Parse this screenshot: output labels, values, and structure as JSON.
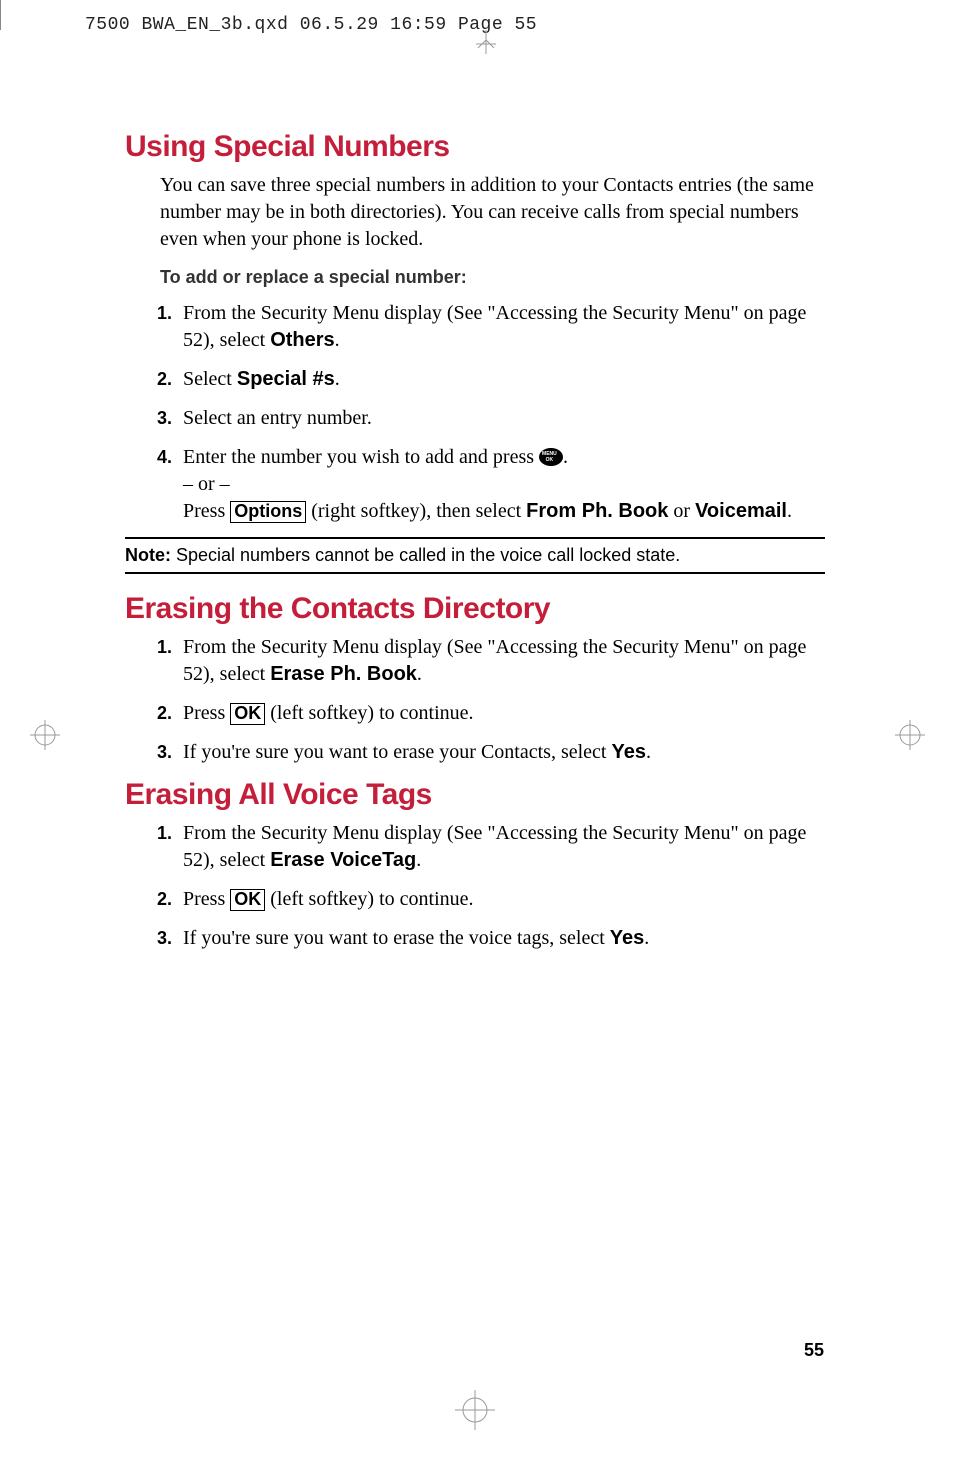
{
  "header_line": "7500 BWA_EN_3b.qxd  06.5.29  16:59  Page 55",
  "section1": {
    "heading": "Using Special Numbers",
    "intro": "You can save three special numbers in addition to your Contacts entries (the same number may be in both directories). You can receive calls from special numbers even when your phone is locked.",
    "subhead": "To add or replace a special number:",
    "step1_a": "From the Security Menu display (See \"Accessing the Security Menu\" on page 52), select ",
    "step1_b": "Others",
    "step2_a": "Select ",
    "step2_b": "Special #s",
    "step3": "Select an entry number.",
    "step4_a": "Enter the number you wish to add and press ",
    "step4_b": ".",
    "step4_or": "– or –",
    "step4_c": "Press ",
    "step4_options": "Options",
    "step4_d": " (right softkey), then select ",
    "step4_e": "From Ph. Book",
    "step4_f": " or ",
    "step4_g": "Voicemail",
    "note_label": "Note:",
    "note_text": " Special numbers cannot be called in the voice call locked state."
  },
  "section2": {
    "heading": "Erasing the Contacts Directory",
    "step1_a": "From the Security Menu display (See \"Accessing the Security Menu\" on page 52), select ",
    "step1_b": "Erase Ph. Book",
    "step2_a": "Press ",
    "step2_ok": "OK",
    "step2_b": " (left softkey) to continue.",
    "step3_a": "If you're sure you want to erase your Contacts, select ",
    "step3_b": "Yes"
  },
  "section3": {
    "heading": "Erasing All Voice Tags",
    "step1_a": "From the Security Menu display (See \"Accessing the Security Menu\" on page 52), select ",
    "step1_b": "Erase VoiceTag",
    "step2_a": "Press ",
    "step2_ok": "OK",
    "step2_b": " (left softkey) to continue.",
    "step3_a": "If you're sure you want to erase the voice tags, select ",
    "step3_b": "Yes"
  },
  "page_number": "55"
}
